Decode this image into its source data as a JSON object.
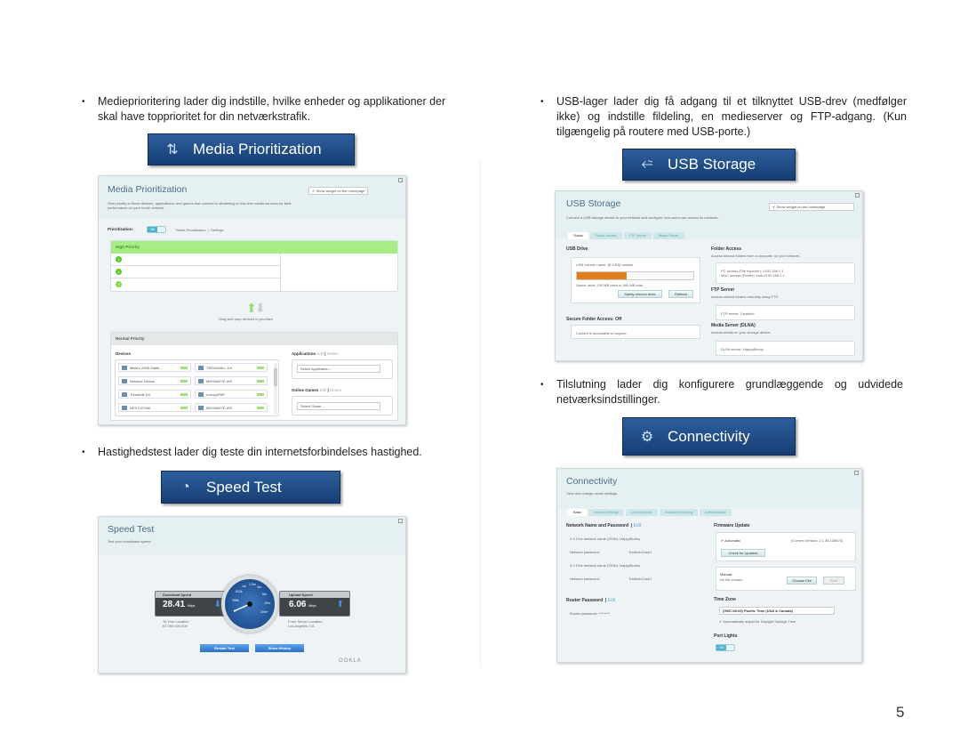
{
  "left_column": {
    "bullet1": "Medieprioritering lader dig indstille, hvilke enheder og applikationer der skal have topprioritet for din netværkstrafik.",
    "bullet2": "Hastighedstest lader dig teste din internetsforbindelses hastighed."
  },
  "right_column": {
    "bullet1": "USB-lager lader dig få adgang til et tilknyttet USB-drev (medfølger ikke) og indstille fildeling, en medieserver og FTP-adgang. (Kun tilgængelig på routere med USB-porte.)",
    "bullet2": "Tilslutning lader dig konfigurere grundlæggende og udvidede netværksindstillinger."
  },
  "bullet_glyph": "•",
  "page_number": "5",
  "media_prioritization": {
    "banner": "Media Prioritization",
    "title": "Media Prioritization",
    "show_widget": "Show widget on the homepage",
    "description": "Give priority to these devices, applications, and games that connect to streaming or real-time media services for best performance on your home network.",
    "prioritization_label": "Prioritization:",
    "toggle": "ON",
    "reset_link": "Reset Prioritization",
    "settings_link": "Settings",
    "high_priority": "High Priority",
    "slots": [
      "1",
      "2",
      "3"
    ],
    "drag_hint": "Drag and drop devices to prioritize",
    "normal_priority": "Normal Priority",
    "devices_label": "Devices",
    "devices": [
      "Mikki's 2008 Galile...",
      "TREADMILL-DX",
      "Network Device",
      "MIKSAWYE-WS",
      "Treadmill-DX",
      "LinksysPAP",
      "NEXTLEXA6",
      "MIKSAWYE-WS"
    ],
    "applications_label": "Applications",
    "edit": "Edit",
    "delete": "Delete",
    "select_application": "Select Application...",
    "online_games_label": "Online Games",
    "select_game": "Select Game...",
    "accent": "#a8ec86"
  },
  "speed_test": {
    "banner": "Speed Test",
    "title": "Speed Test",
    "subtitle": "Test your broadband speed.",
    "download_label": "Download Speed",
    "download_value": "28.41",
    "download_unit": "Mbps",
    "download_note1": "To Your Location",
    "download_note2": "67.000.000.000",
    "upload_label": "Upload Speed",
    "upload_value": "6.06",
    "upload_unit": "Mbps",
    "upload_note1": "From Server Location:",
    "upload_note2": "Los Angeles, CA",
    "gauge_labels": [
      "0",
      "256k",
      "512k",
      "1m",
      "1.5m",
      "3m",
      "5m",
      "10m",
      "20m+"
    ],
    "restart": "Restart Test",
    "history": "Show History",
    "brand": "OOKLA"
  },
  "usb_storage": {
    "banner": "USB Storage",
    "title": "USB Storage",
    "show_widget": "Show widget on the homepage",
    "description": "Connect a USB storage device to your network and configure how users can access its contents.",
    "tabs": [
      "Status",
      "Folder Access",
      "FTP Server",
      "Media Server"
    ],
    "usb_drive": "USB Drive",
    "volume": "USB volume name: (E-USB) sardisk",
    "space": "Space used: 204 MB used of 480 MB total",
    "used_fraction": 0.43,
    "safely_remove": "Safely remove drive",
    "refresh": "Refresh",
    "secure_folder": "Secure Folder Access: Off",
    "secure_text": "Content is accessible to anyone.",
    "folder_access": "Folder Access",
    "folder_desc": "Access shared folders from a computer on your network.",
    "pc_access": "PC access (File explorer): \\\\192.168.1.1",
    "mac_access": "MAC access (Finder): smb://192.168.1.1",
    "ftp_server": "FTP Server",
    "ftp_desc": "Access shared folders remotely using FTP.",
    "ftp_status": "FTP server: Disabled",
    "media_server": "Media Server (DLNA)",
    "media_desc": "Access media on your storage device.",
    "dlna_status": "DLNA server: HappyBunny",
    "bar_color": "#e0801c"
  },
  "connectivity": {
    "banner": "Connectivity",
    "title": "Connectivity",
    "subtitle": "View and change router settings.",
    "tabs": [
      "Basic",
      "Internet Settings",
      "Local Network",
      "Advanced Routing",
      "Administration"
    ],
    "network_heading": "Network Name and Password",
    "edit": "Edit",
    "rows": [
      {
        "label": "2.4 GHz network name (SSID):",
        "value": "HappyBunny"
      },
      {
        "label": "Network password:",
        "value": "TrkMzrhOuse1"
      },
      {
        "label": "5.0 GHz network name (SSID):",
        "value": "HappyBunny"
      },
      {
        "label": "Network password:",
        "value": "TrkMzrhOuse1"
      }
    ],
    "router_password": "Router Password",
    "router_row_label": "Router password:",
    "router_row_value": "********",
    "firmware_update": "Firmware Update",
    "automatic": "Automatic",
    "current_version": "(Current Version: 2.1.38.138870)",
    "check_updates": "Check for Updates",
    "manual": "Manual:",
    "no_file": "No file chosen",
    "choose_file": "Choose File",
    "start": "Start",
    "time_zone": "Time Zone",
    "tz_value": "(GMT-08:00) Pacific Time (USA & Canada)",
    "dst": "Automatically adjust for Daylight Savings Time",
    "port_lights": "Port Lights",
    "toggle": "ON"
  }
}
